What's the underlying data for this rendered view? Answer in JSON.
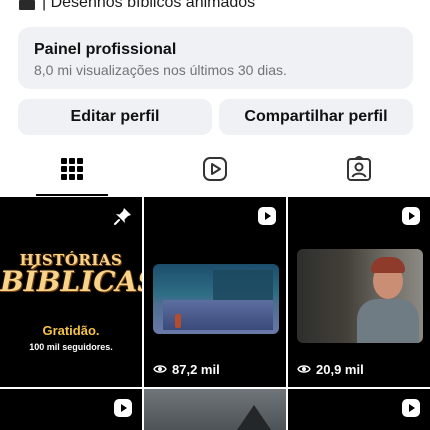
{
  "bio": {
    "text": "| Desenhos bíblicos animados",
    "icon": "clapperboard-icon"
  },
  "professional_panel": {
    "title": "Painel profissional",
    "subtitle": "8,0 mi visualizações nos últimos 30 dias."
  },
  "actions": {
    "edit_label": "Editar perfil",
    "share_label": "Compartilhar perfil"
  },
  "tabs": [
    {
      "icon": "grid-icon",
      "selected": true
    },
    {
      "icon": "reels-icon",
      "selected": false
    },
    {
      "icon": "tagged-icon",
      "selected": false
    }
  ],
  "posts": [
    {
      "type": "pinned",
      "logo_top": "HISTÓRIAS",
      "logo_bottom": "BÍBLICAS",
      "caption": "Gratidão.",
      "subcaption": "100 mil seguidores."
    },
    {
      "type": "reel",
      "views": "87,2 mil"
    },
    {
      "type": "reel",
      "views": "20,9 mil"
    },
    {
      "type": "reel"
    },
    {
      "type": "image"
    },
    {
      "type": "reel"
    }
  ],
  "colors": {
    "panel_bg": "#eff1f5",
    "logo_gold": "#f7d48a",
    "caption_gold": "#f5c24a"
  }
}
